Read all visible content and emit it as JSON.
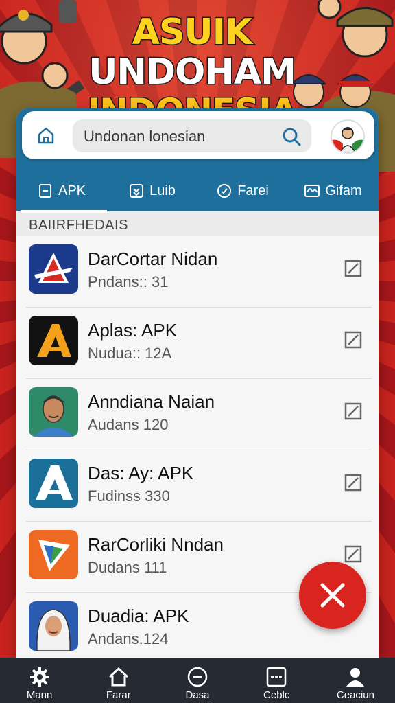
{
  "banner": {
    "line1_a": "ASUIK",
    "line1_b": "UNDOHAM",
    "line2": "INDONESIA"
  },
  "search": {
    "text": "Undonan lonesian"
  },
  "tabs": [
    {
      "label": "APK",
      "icon": "document-icon",
      "active": true
    },
    {
      "label": "Luib",
      "icon": "download-icon",
      "active": false
    },
    {
      "label": "Farei",
      "icon": "check-circle-icon",
      "active": false
    },
    {
      "label": "Gifam",
      "icon": "image-icon",
      "active": false
    }
  ],
  "section_title": "BAIIRFHEDAIS",
  "apps": [
    {
      "title": "DarCortar Nidan",
      "subtitle": "Pndans:: 31",
      "icon": "red-a-logo-icon"
    },
    {
      "title": "Aplas: APK",
      "subtitle": "Nudua:: 12A",
      "icon": "orange-a-logo-icon"
    },
    {
      "title": "Anndiana Naian",
      "subtitle": "Audans 120",
      "icon": "man-portrait-icon"
    },
    {
      "title": "Das: Ay: APK",
      "subtitle": "Fudinss 330",
      "icon": "blue-a-logo-icon"
    },
    {
      "title": "RarCorliki Nndan",
      "subtitle": "Dudans 111",
      "icon": "play-triangle-logo-icon"
    },
    {
      "title": "Duadia: APK",
      "subtitle": "Andans.124",
      "icon": "hijab-woman-portrait-icon"
    }
  ],
  "bottom_nav": [
    {
      "label": "Mann",
      "icon": "gear-icon"
    },
    {
      "label": "Farar",
      "icon": "home-icon"
    },
    {
      "label": "Dasa",
      "icon": "minus-circle-icon"
    },
    {
      "label": "Ceblc",
      "icon": "dots-box-icon"
    },
    {
      "label": "Ceaciun",
      "icon": "person-icon"
    }
  ],
  "colors": {
    "header": "#1e6f9b",
    "fab": "#d9241f",
    "nav": "#262a33",
    "background": "#b81d1a"
  }
}
